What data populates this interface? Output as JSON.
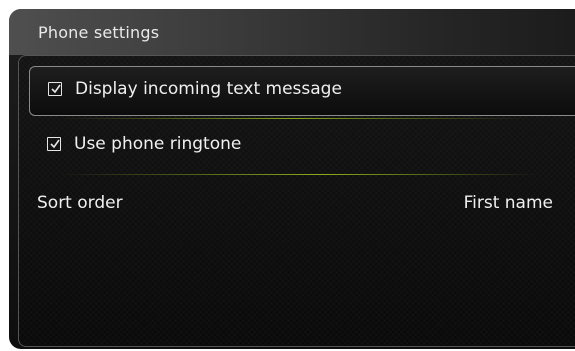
{
  "header": {
    "title": "Phone settings"
  },
  "settings": {
    "items": [
      {
        "label": "Display incoming text message",
        "checked": true,
        "selected": true
      },
      {
        "label": "Use phone ringtone",
        "checked": true,
        "selected": false
      }
    ],
    "sort_order": {
      "label": "Sort order",
      "value": "First name"
    }
  },
  "colors": {
    "accent_divider": "#96be1e",
    "text": "#f0f0f0",
    "background": "#0e0e0e"
  },
  "icons": {
    "checkbox": "checkbox-checked-icon"
  }
}
